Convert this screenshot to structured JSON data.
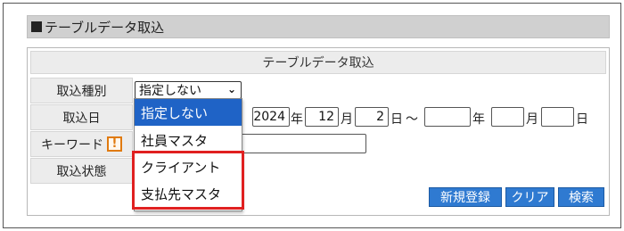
{
  "section_title": "テーブルデータ取込",
  "panel_title": "テーブルデータ取込",
  "rows": {
    "type_label": "取込種別",
    "date_label": "取込日",
    "keyword_label": "キーワード",
    "status_label": "取込状態"
  },
  "warning_icon_glyph": "!",
  "type_select": {
    "selected": "指定しない",
    "chevron": "⌄",
    "options": [
      "指定しない",
      "社員マスタ",
      "クライアント",
      "支払先マスタ"
    ]
  },
  "date_from": {
    "year": "2024",
    "month": "12",
    "day": "2"
  },
  "date_to": {
    "year": "",
    "month": "",
    "day": ""
  },
  "units": {
    "year": "年",
    "month": "月",
    "day": "日",
    "range": "～"
  },
  "keyword_value": "",
  "buttons": {
    "new": "新規登録",
    "clear": "クリア",
    "search": "検索"
  },
  "colors": {
    "accent_button": "#2f7ad1",
    "selected_option": "#1f63c6",
    "highlight_box": "#e02020",
    "warning": "#e07a10"
  }
}
